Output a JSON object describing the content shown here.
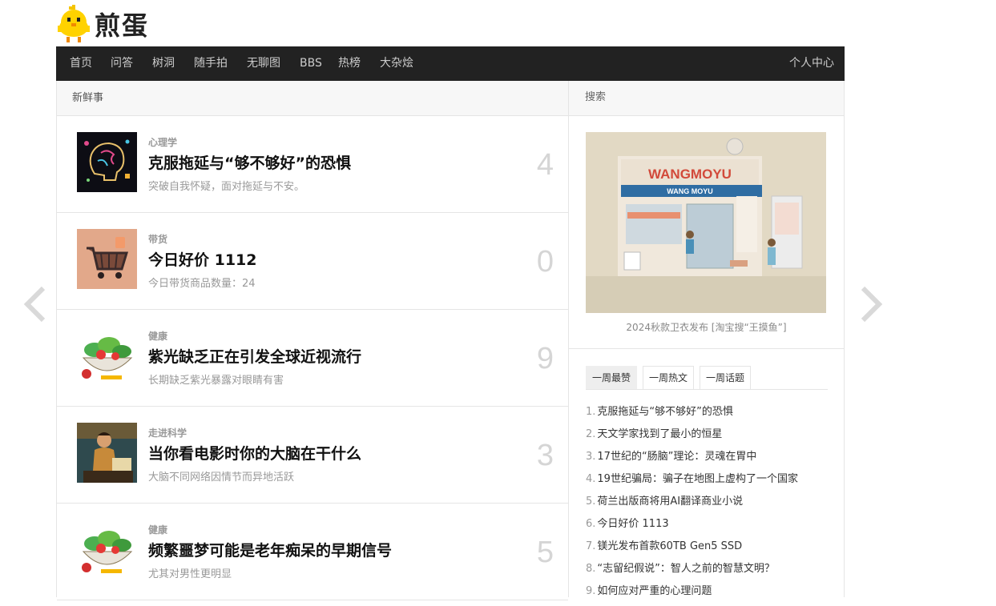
{
  "site": {
    "logo_text": "煎蛋"
  },
  "nav": {
    "items": [
      "首页",
      "问答",
      "树洞",
      "随手拍",
      "无聊图",
      "BBS",
      "热榜",
      "大杂烩"
    ],
    "user_center": "个人中心"
  },
  "main": {
    "section_title": "新鲜事",
    "posts": [
      {
        "category": "心理学",
        "title": "克服拖延与“够不够好”的恐惧",
        "desc": "突破自我怀疑，面对拖延与不安。",
        "count": "4",
        "thumb": "brain-art"
      },
      {
        "category": "带货",
        "title": "今日好价 1112",
        "desc": "今日带货商品数量：24",
        "count": "0",
        "thumb": "shopping-cart"
      },
      {
        "category": "健康",
        "title": "紫光缺乏正在引发全球近视流行",
        "desc": "长期缺乏紫光暴露对眼睛有害",
        "count": "9",
        "thumb": "vegetable-bowl"
      },
      {
        "category": "走进科学",
        "title": "当你看电影时你的大脑在干什么",
        "desc": "大脑不同网络因情节而异地活跃",
        "count": "3",
        "thumb": "man-reading"
      },
      {
        "category": "健康",
        "title": "频繁噩梦可能是老年痴呆的早期信号",
        "desc": "尤其对男性更明显",
        "count": "5",
        "thumb": "vegetable-bowl"
      }
    ]
  },
  "sidebar": {
    "search_title": "搜索",
    "ad": {
      "sign": "WANGMOYU",
      "sub_sign": "WANG  MOYU",
      "caption": "2024秋款卫衣发布 [淘宝搜“王摸鱼”]"
    },
    "tabs": [
      "一周最赞",
      "一周热文",
      "一周话题"
    ],
    "ranking": [
      {
        "num": "1.",
        "title": "克服拖延与“够不够好”的恐惧"
      },
      {
        "num": "2.",
        "title": "天文学家找到了最小的恒星"
      },
      {
        "num": "3.",
        "title": "17世纪的“肠脑”理论：灵魂在胃中"
      },
      {
        "num": "4.",
        "title": "19世纪骗局：骗子在地图上虚构了一个国家"
      },
      {
        "num": "5.",
        "title": "荷兰出版商将用AI翻译商业小说"
      },
      {
        "num": "6.",
        "title": "今日好价 1113"
      },
      {
        "num": "7.",
        "title": "镁光发布首款60TB Gen5 SSD"
      },
      {
        "num": "8.",
        "title": "“志留纪假说”：智人之前的智慧文明？"
      },
      {
        "num": "9.",
        "title": "如何应对严重的心理问题"
      }
    ]
  },
  "colors": {
    "nav_bg": "#222222",
    "border": "#e5e5e5",
    "count": "#d5d5d5"
  }
}
